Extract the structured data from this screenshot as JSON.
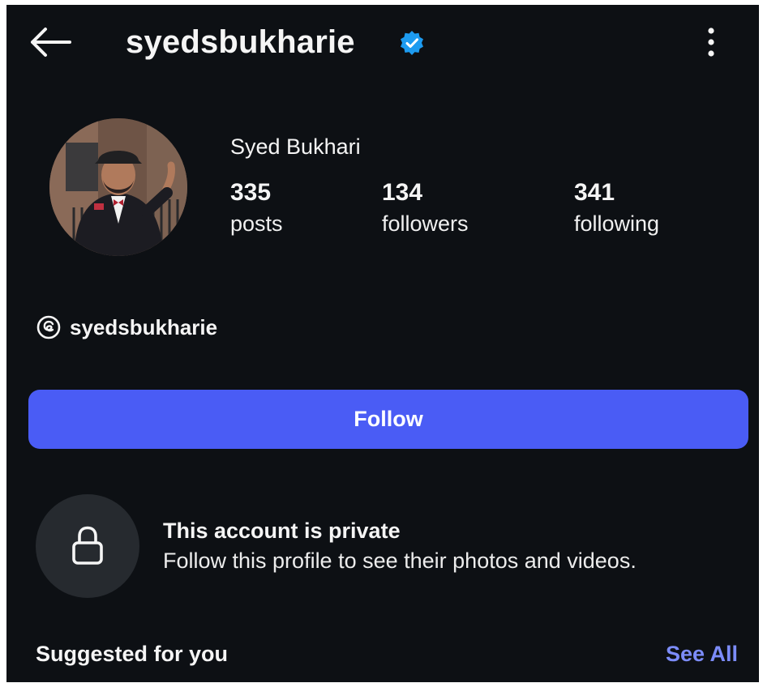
{
  "header": {
    "username": "syedsbukharie",
    "back_icon": "arrow-left-icon",
    "verified_icon": "verified-badge-icon",
    "verified_color": "#1d9bf0",
    "more_icon": "more-vertical-icon"
  },
  "profile": {
    "display_name": "Syed Bukhari",
    "stats": [
      {
        "value": "335",
        "label": "posts"
      },
      {
        "value": "134",
        "label": "followers"
      },
      {
        "value": "341",
        "label": "following"
      }
    ],
    "threads_handle": "syedsbukharie",
    "threads_icon": "threads-icon"
  },
  "actions": {
    "follow_label": "Follow",
    "follow_color": "#4a5cf5"
  },
  "private_notice": {
    "icon": "lock-icon",
    "title": "This account is private",
    "subtitle": "Follow this profile to see their photos and videos."
  },
  "suggestions": {
    "title": "Suggested for you",
    "see_all_label": "See All",
    "see_all_color": "#7c8cf9"
  }
}
